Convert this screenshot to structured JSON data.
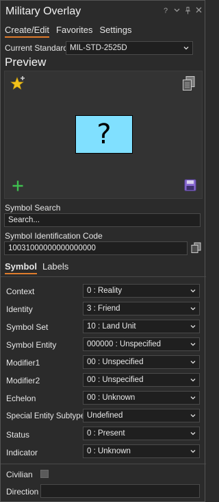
{
  "window": {
    "title": "Military Overlay",
    "icons": [
      "help-icon",
      "dropdown-icon",
      "pin-icon",
      "close-icon"
    ]
  },
  "tabs": [
    {
      "label": "Create/Edit",
      "active": true
    },
    {
      "label": "Favorites",
      "active": false
    },
    {
      "label": "Settings",
      "active": false
    }
  ],
  "standard": {
    "label": "Current Standard:",
    "value": "MIL-STD-2525D"
  },
  "preview": {
    "title": "Preview",
    "symbol_glyph": "?",
    "symbol_fill": "#80e0ff"
  },
  "search": {
    "label": "Symbol Search",
    "placeholder": "Search..."
  },
  "sic": {
    "label": "Symbol Identification Code",
    "value": "10031000000000000000"
  },
  "subtabs": [
    {
      "label": "Symbol",
      "active": true
    },
    {
      "label": "Labels",
      "active": false
    }
  ],
  "properties": [
    {
      "label": "Context",
      "value": "0 : Reality"
    },
    {
      "label": "Identity",
      "value": "3 : Friend"
    },
    {
      "label": "Symbol Set",
      "value": "10 : Land Unit"
    },
    {
      "label": "Symbol Entity",
      "value": "000000 : Unspecified"
    },
    {
      "label": "Modifier1",
      "value": "00 : Unspecified"
    },
    {
      "label": "Modifier2",
      "value": "00 : Unspecified"
    },
    {
      "label": "Echelon",
      "value": "00 : Unknown"
    },
    {
      "label": "Special Entity Subtype",
      "value": "Undefined"
    },
    {
      "label": "Status",
      "value": "0 : Present"
    },
    {
      "label": "Indicator",
      "value": "0 : Unknown"
    }
  ],
  "civilian": {
    "label": "Civilian",
    "checked": false
  },
  "direction": {
    "label": "Direction",
    "value": ""
  },
  "colors": {
    "accent": "#e07c2c",
    "add": "#3fbf4f",
    "save": "#8a6bd1",
    "star": "#f2c21b"
  }
}
